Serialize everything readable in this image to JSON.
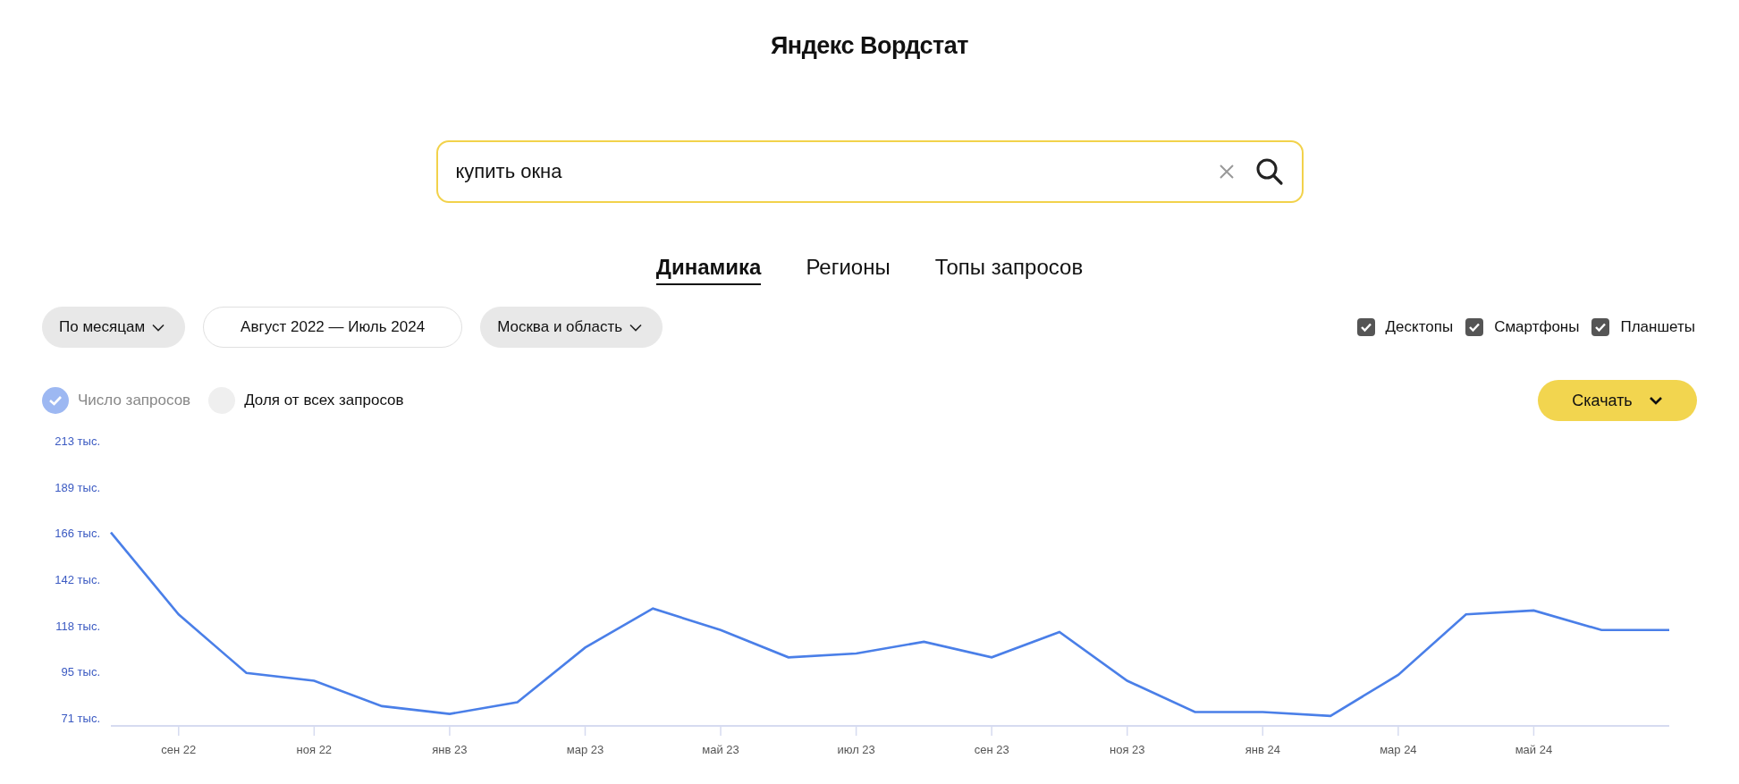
{
  "header": {
    "title": "Яндекс Вордстат"
  },
  "search": {
    "value": "купить окна"
  },
  "tabs": [
    {
      "label": "Динамика",
      "selected": true
    },
    {
      "label": "Регионы",
      "selected": false
    },
    {
      "label": "Топы запросов",
      "selected": false
    }
  ],
  "filters": [
    {
      "kind": "dropdown",
      "label": "По месяцам"
    },
    {
      "kind": "range",
      "label": "Август 2022 — Июль 2024"
    },
    {
      "kind": "dropdown",
      "label": "Москва и область"
    }
  ],
  "devices": [
    {
      "label": "Десктопы",
      "checked": true
    },
    {
      "label": "Смартфоны",
      "checked": true
    },
    {
      "label": "Планшеты",
      "checked": true
    }
  ],
  "metrics": [
    {
      "label": "Число запросов",
      "selected": true
    },
    {
      "label": "Доля от всех запросов",
      "selected": false
    }
  ],
  "download_button": {
    "label": "Скачать"
  },
  "chart": {
    "chart_data": {
      "type": "line",
      "categories": [
        null,
        "сен 22",
        null,
        "ноя 22",
        null,
        "янв 23",
        null,
        "мар 23",
        null,
        "май 23",
        null,
        "июл 23",
        null,
        "сен 23",
        null,
        "ноя 23",
        null,
        "янв 24",
        null,
        "мар 24",
        null,
        "май 24",
        null,
        null
      ],
      "series": [
        {
          "color": "#4a7fe8",
          "values": [
            166,
            124,
            94,
            90,
            77,
            73,
            79,
            107,
            127,
            116,
            102,
            104,
            110,
            102,
            115,
            90,
            74,
            74,
            72,
            93,
            124,
            126,
            116,
            116
          ]
        }
      ],
      "ylim": [
        71,
        213
      ],
      "yticks": [
        {
          "value": 71,
          "label": "71 тыс."
        },
        {
          "value": 95,
          "label": "95 тыс."
        },
        {
          "value": 118,
          "label": "118 тыс."
        },
        {
          "value": 142,
          "label": "142 тыс."
        },
        {
          "value": 166,
          "label": "166 тыс."
        },
        {
          "value": 189,
          "label": "189 тыс."
        },
        {
          "value": 213,
          "label": "213 тыс."
        }
      ]
    }
  }
}
